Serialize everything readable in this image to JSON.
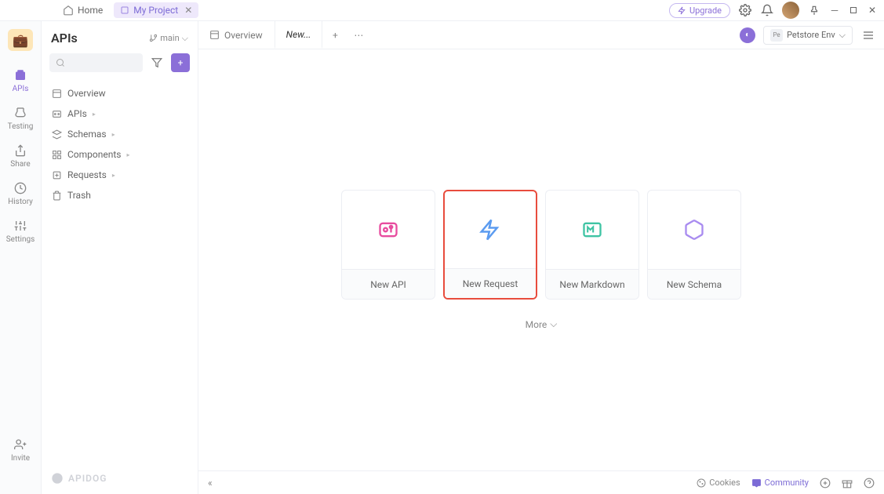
{
  "topbar": {
    "home_label": "Home",
    "project_label": "My Project",
    "upgrade_label": "Upgrade"
  },
  "rail": {
    "items": [
      {
        "label": "APIs",
        "active": true
      },
      {
        "label": "Testing"
      },
      {
        "label": "Share"
      },
      {
        "label": "History"
      },
      {
        "label": "Settings"
      }
    ],
    "invite_label": "Invite"
  },
  "sidebar": {
    "title": "APIs",
    "branch": "main",
    "tree": [
      {
        "label": "Overview"
      },
      {
        "label": "APIs",
        "expandable": true
      },
      {
        "label": "Schemas",
        "expandable": true
      },
      {
        "label": "Components",
        "expandable": true
      },
      {
        "label": "Requests",
        "expandable": true
      },
      {
        "label": "Trash"
      }
    ],
    "footer_brand": "APIDOG"
  },
  "tabs": {
    "items": [
      {
        "label": "Overview",
        "active": false
      },
      {
        "label": "New...",
        "active": true
      }
    ],
    "env_label": "Petstore Env",
    "env_badge": "Pe"
  },
  "canvas": {
    "cards": [
      {
        "label": "New API",
        "color": "#e84c9f",
        "icon": "api"
      },
      {
        "label": "New Request",
        "color": "#5b9bf0",
        "icon": "request",
        "highlighted": true
      },
      {
        "label": "New Markdown",
        "color": "#3fc4a4",
        "icon": "markdown"
      },
      {
        "label": "New Schema",
        "color": "#a98cf0",
        "icon": "schema"
      }
    ],
    "more_label": "More"
  },
  "bottombar": {
    "cookies_label": "Cookies",
    "community_label": "Community"
  }
}
